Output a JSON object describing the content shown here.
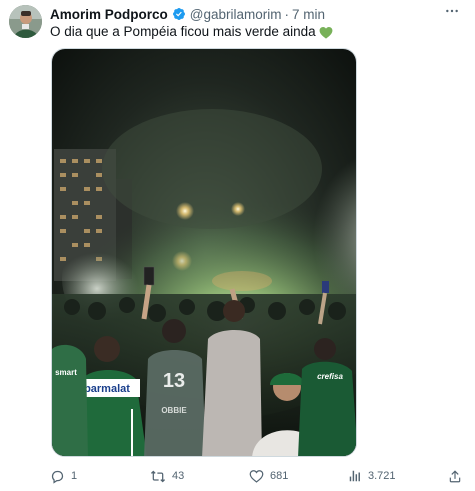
{
  "tweet": {
    "display_name": "Amorim Podporco",
    "handle": "@gabrilamorim",
    "separator": "·",
    "time": "7 min",
    "text": "O dia que a Pompéia ficou mais verde ainda",
    "emoji": "green-heart",
    "media": {
      "banner_text": "parmalat",
      "jersey_number": "13",
      "jersey_name": "OBBIE",
      "sponsor_text": "crefisa",
      "small_text": "smart"
    },
    "actions": {
      "reply_count": "1",
      "retweet_count": "43",
      "like_count": "681",
      "views_count": "3.721"
    }
  },
  "icons": {
    "verified": "verified-badge-icon",
    "more": "more-icon",
    "reply": "reply-icon",
    "retweet": "retweet-icon",
    "like": "like-icon",
    "views": "views-icon",
    "share": "share-icon"
  },
  "colors": {
    "verified_blue": "#1d9bf0",
    "muted_text": "#536471",
    "green_heart": "#78b159",
    "smoke_green": "#7fbf6a"
  }
}
